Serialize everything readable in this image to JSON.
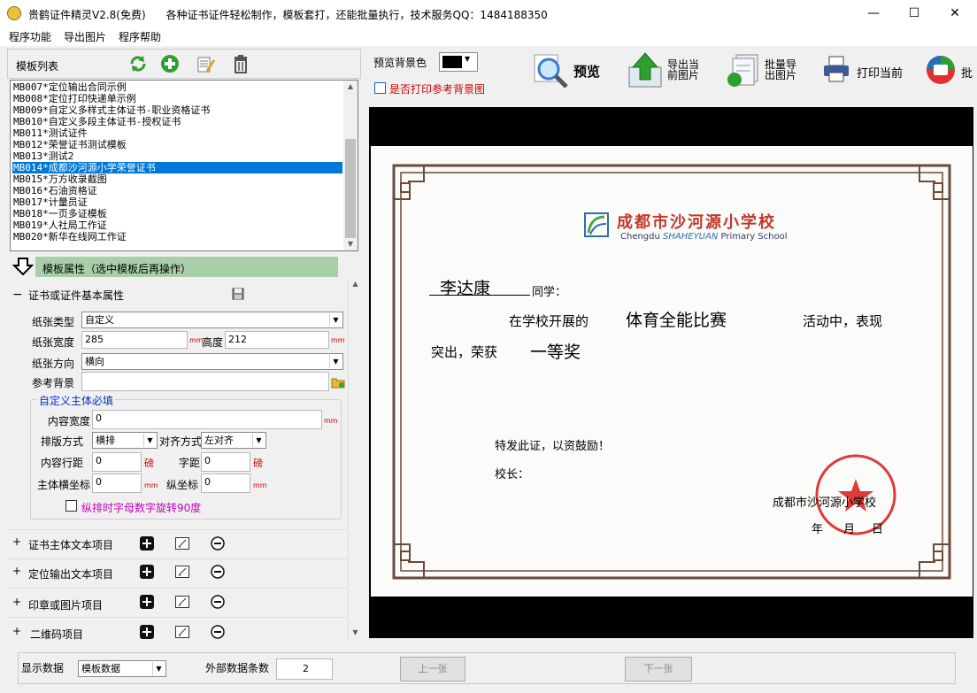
{
  "window": {
    "title": "贵鹤证件精灵V2.8(免费)      各种证书证件轻松制作，模板套打，还能批量执行，技术服务QQ：1484188350",
    "minimize": "—",
    "maximize": "☐",
    "close": "✕"
  },
  "menu": [
    "程序功能",
    "导出图片",
    "程序帮助"
  ],
  "template_list": {
    "header": "模板列表",
    "toolbar_icons": [
      "refresh-icon",
      "add-icon",
      "edit-icon",
      "delete-icon"
    ],
    "items": [
      "MB007*定位输出合同示例",
      "MB008*定位打印快递单示例",
      "MB009*自定义多样式主体证书-职业资格证书",
      "MB010*自定义多段主体证书-授权证书",
      "MB011*测试证件",
      "MB012*荣誉证书测试模板",
      "MB013*测试2",
      "MB014*成都沙河源小学荣誉证书",
      "MB015*万方收录截图",
      "MB016*石油资格证",
      "MB017*计量员证",
      "MB018*一页多证模板",
      "MB019*人社局工作证",
      "MB020*新华在线网工作证"
    ],
    "selected_index": 7
  },
  "props": {
    "header": "模板属性（选中模板后再操作）",
    "basic_section": "证书或证件基本属性",
    "collapse_minus": "−",
    "paper_type_label": "纸张类型",
    "paper_type_value": "自定义",
    "width_label": "纸张宽度",
    "width_value": "285",
    "height_label": "高度",
    "height_value": "212",
    "unit_mm": "mm",
    "orientation_label": "纸张方向",
    "orientation_value": "横向",
    "ref_bg_label": "参考背景",
    "ref_bg_value": "",
    "custom_group_title": "自定义主体必填",
    "content_width_label": "内容宽度",
    "content_width_value": "0",
    "layout_label": "排版方式",
    "layout_value": "横排",
    "align_label": "对齐方式",
    "align_value": "左对齐",
    "line_spacing_label": "内容行距",
    "line_spacing_value": "0",
    "unit_bang": "磅",
    "char_spacing_label": "字距",
    "char_spacing_value": "0",
    "x_label": "主体横坐标",
    "x_value": "0",
    "y_label": "纵坐标",
    "y_value": "0",
    "rotate_checkbox_label": "纵排时字母数字旋转90度",
    "rotate_checked": false,
    "groups": [
      {
        "plus": "+",
        "label": "证书主体文本项目"
      },
      {
        "plus": "+",
        "label": "定位输出文本项目"
      },
      {
        "plus": "+",
        "label": "印章或图片项目"
      },
      {
        "plus": "+",
        "label": "二维码项目"
      }
    ]
  },
  "right_toolbar": {
    "bg_color_label": "预览背景色",
    "bg_color_value": "#000000",
    "print_ref_bg_label": "是否打印参考背景图",
    "print_ref_bg_checked": false,
    "preview_label": "预览",
    "export_current": [
      "导出当",
      "前图片"
    ],
    "batch_export": [
      "批量导",
      "出图片"
    ],
    "print_current": "打印当前",
    "batch_print_partial": "批"
  },
  "certificate": {
    "school_cn": "成都市沙河源小学校",
    "school_en_1": "Chengdu ",
    "school_en_2": "SHAHEYUAN",
    "school_en_3": " Primary School",
    "student_name": "李达康",
    "greeting": "同学：",
    "line2_prefix": "在学校开展的",
    "event": "体育全能比赛",
    "line2_suffix": "活动中，表现",
    "line3_prefix": "突出，荣获",
    "award": "一等奖",
    "issue_note": "特发此证，以资鼓励！",
    "principal": "校长：",
    "issuer": "成都市沙河源小学校",
    "date_year": "年",
    "date_month": "月",
    "date_day": "日",
    "seal_text": "成都市沙河源小学",
    "colors": {
      "border": "#6b4a3a",
      "logo_blue": "#2a6fb5",
      "logo_green": "#4aa84a",
      "title_red": "#c0392b",
      "seal": "#d81818"
    }
  },
  "bottom": {
    "display_data_label": "显示数据",
    "display_data_value": "模板数据",
    "external_count_label": "外部数据条数",
    "external_count_value": "2",
    "prev_button": "上一张",
    "next_button": "下一张"
  }
}
